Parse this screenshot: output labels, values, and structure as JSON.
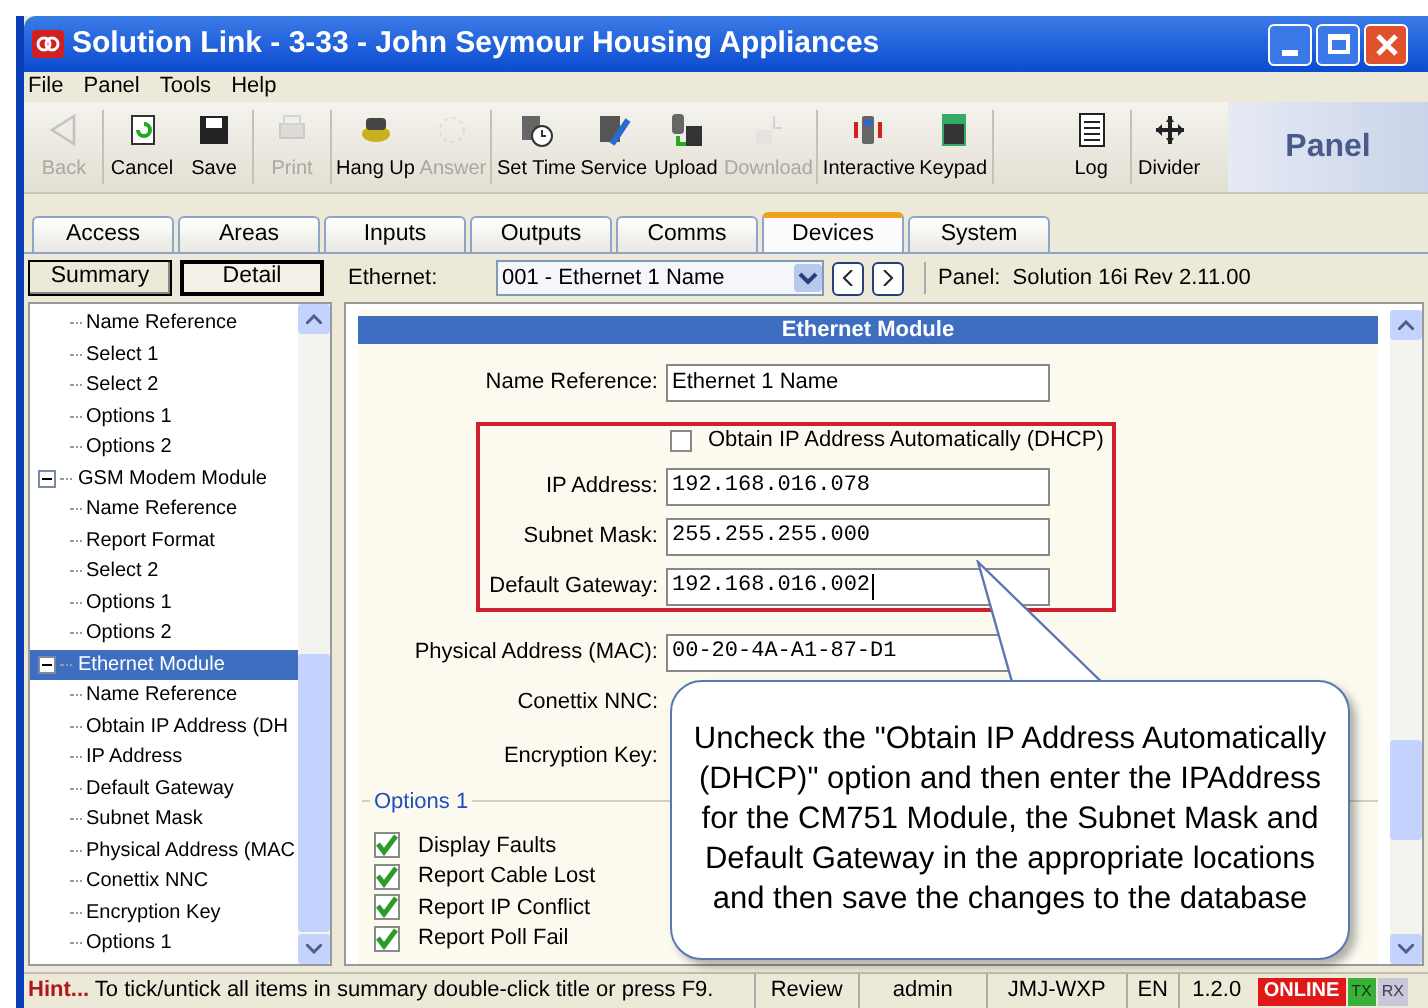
{
  "window": {
    "title": "Solution Link - 3-33 - John Seymour Housing Appliances"
  },
  "menu": [
    "File",
    "Panel",
    "Tools",
    "Help"
  ],
  "toolbar": [
    {
      "label": "Back",
      "disabled": true
    },
    {
      "label": "Cancel",
      "disabled": false
    },
    {
      "label": "Save",
      "disabled": false
    },
    {
      "label": "Print",
      "disabled": true
    },
    {
      "label": "Hang Up",
      "disabled": false
    },
    {
      "label": "Answer",
      "disabled": true
    },
    {
      "label": "Set Time",
      "disabled": false
    },
    {
      "label": "Service",
      "disabled": false
    },
    {
      "label": "Upload",
      "disabled": false
    },
    {
      "label": "Download",
      "disabled": true
    },
    {
      "label": "Interactive",
      "disabled": false
    },
    {
      "label": "Keypad",
      "disabled": false
    },
    {
      "label": "Log",
      "disabled": false
    },
    {
      "label": "Divider",
      "disabled": false
    }
  ],
  "panel_label": "Panel",
  "tabs": [
    {
      "label": "Access",
      "selected": false
    },
    {
      "label": "Areas",
      "selected": false
    },
    {
      "label": "Inputs",
      "selected": false
    },
    {
      "label": "Outputs",
      "selected": false
    },
    {
      "label": "Comms",
      "selected": false
    },
    {
      "label": "Devices",
      "selected": true
    },
    {
      "label": "System",
      "selected": false
    }
  ],
  "view_buttons": [
    {
      "label": "Summary",
      "selected": false
    },
    {
      "label": "Detail",
      "selected": true
    }
  ],
  "device_label": "Ethernet:",
  "device_select": "001 - Ethernet 1 Name",
  "panel_info": "Panel:  Solution 16i Rev 2.11.00",
  "tree": [
    {
      "children": [
        {
          "label": "Name Reference"
        },
        {
          "label": "Select 1"
        },
        {
          "label": "Select 2"
        },
        {
          "label": "Options 1"
        },
        {
          "label": "Options 2"
        }
      ]
    },
    {
      "label": "GSM Modem Module",
      "expanded": true,
      "selected": false,
      "children": [
        {
          "label": "Name Reference"
        },
        {
          "label": "Report Format"
        },
        {
          "label": "Select 2"
        },
        {
          "label": "Options 1"
        },
        {
          "label": "Options 2"
        }
      ]
    },
    {
      "label": "Ethernet Module",
      "expanded": true,
      "selected": true,
      "children": [
        {
          "label": "Name Reference"
        },
        {
          "label": "Obtain IP Address (DH"
        },
        {
          "label": "IP Address"
        },
        {
          "label": "Default Gateway"
        },
        {
          "label": "Subnet Mask"
        },
        {
          "label": "Physical Address (MAC"
        },
        {
          "label": "Conettix NNC"
        },
        {
          "label": "Encryption Key"
        },
        {
          "label": "Options 1"
        }
      ]
    }
  ],
  "section_title": "Ethernet Module",
  "form": [
    {
      "kind": "text",
      "label": "Name Reference:",
      "value": "Ethernet 1 Name",
      "mono": false
    },
    {
      "kind": "checkbox",
      "label": "Obtain IP Address Automatically (DHCP)",
      "checked": false
    },
    {
      "kind": "text",
      "label": "IP Address:",
      "value": "192.168.016.078",
      "mono": true
    },
    {
      "kind": "text",
      "label": "Subnet Mask:",
      "value": "255.255.255.000",
      "mono": true
    },
    {
      "kind": "text",
      "label": "Default Gateway:",
      "value": "192.168.016.002",
      "mono": true,
      "focused": true
    },
    {
      "kind": "text",
      "label": "Physical Address (MAC):",
      "value": "00-20-4A-A1-87-D1",
      "mono": true
    },
    {
      "kind": "label",
      "label": "Conettix NNC:"
    },
    {
      "kind": "label",
      "label": "Encryption Key:"
    }
  ],
  "options_group": {
    "title": "Options 1",
    "items": [
      {
        "label": "Display Faults",
        "checked": true
      },
      {
        "label": "Report Cable Lost",
        "checked": true
      },
      {
        "label": "Report IP Conflict",
        "checked": true
      },
      {
        "label": "Report Poll Fail",
        "checked": true
      }
    ]
  },
  "callout": "Uncheck the \"Obtain IP Address Automatically (DHCP)\" option and then enter the IPAddress for the CM751 Module, the Subnet Mask and Default Gateway in the appropriate locations and then save the changes to the database",
  "status_bar": {
    "hint_label": "Hint...",
    "hint": "To tick/untick all items in summary double-click title or press F9.",
    "fields": [
      "Review",
      "admin",
      "JMJ-WXP",
      "EN",
      "1.2.0"
    ],
    "online": "ONLINE",
    "indicators": [
      {
        "label": "TX",
        "on": true
      },
      {
        "label": "RX",
        "on": false
      }
    ]
  }
}
